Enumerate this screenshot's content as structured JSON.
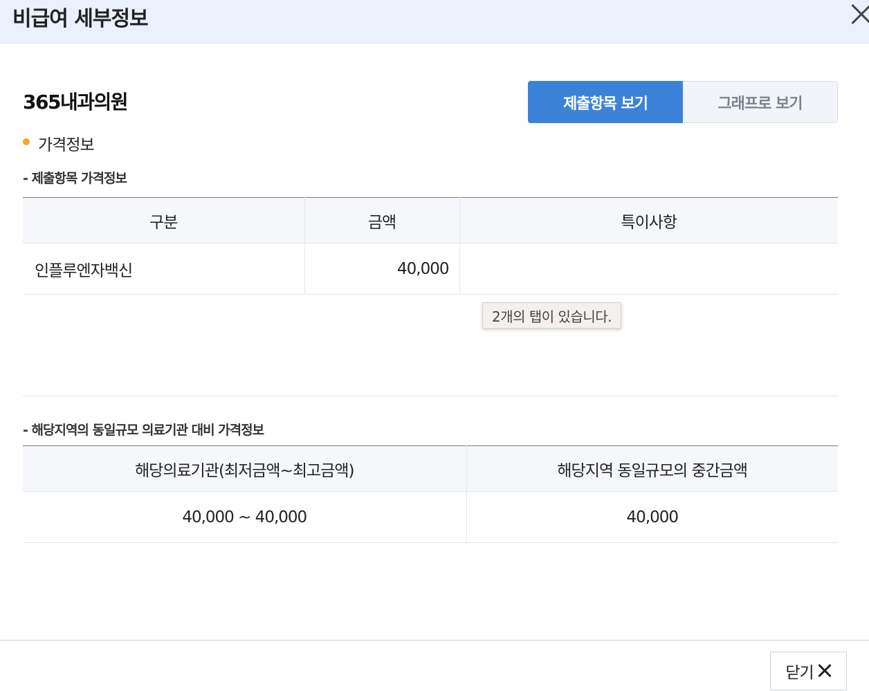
{
  "header": {
    "title": "비급여 세부정보"
  },
  "hospital_name": "365내과의원",
  "tabs": {
    "submitted": "제출항목 보기",
    "graph": "그래프로 보기"
  },
  "section_title": "가격정보",
  "submitted_price": {
    "subtitle": "- 제출항목 가격정보",
    "headers": [
      "구분",
      "금액",
      "특이사항"
    ],
    "rows": [
      {
        "category": "인플루엔자백신",
        "amount": "40,000",
        "note": ""
      }
    ]
  },
  "tooltip": "2개의 탭이 있습니다.",
  "regional_price": {
    "subtitle": "- 해당지역의 동일규모 의료기관 대비 가격정보",
    "headers": [
      "해당의료기관(최저금액~최고금액)",
      "해당지역 동일규모의 중간금액"
    ],
    "rows": [
      {
        "range": "40,000 ~ 40,000",
        "median": "40,000"
      }
    ]
  },
  "footer": {
    "close_label": "닫기"
  }
}
